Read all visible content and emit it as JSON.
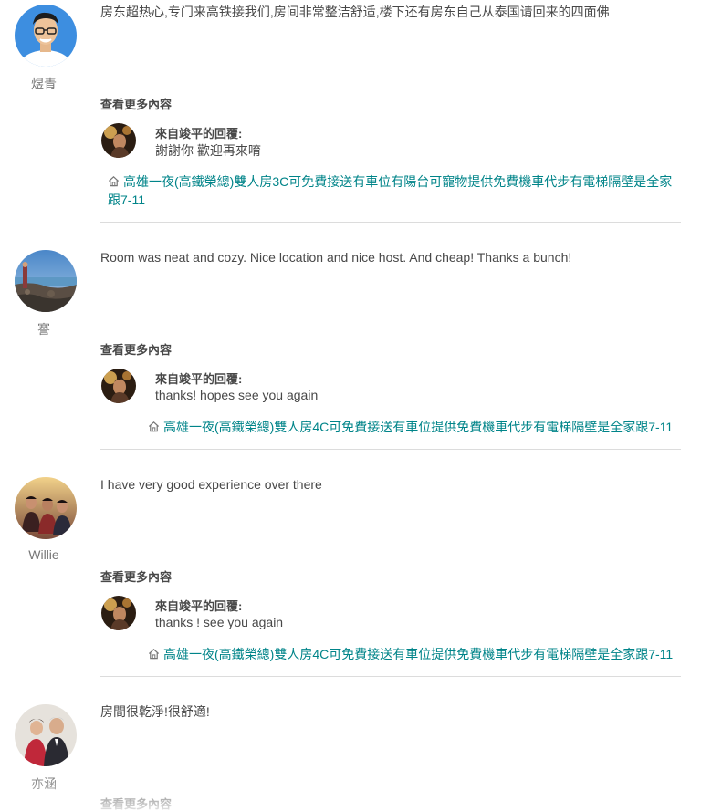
{
  "reviews": [
    {
      "reviewer": "煜青",
      "text": "房东超热心,专门来高铁接我们,房间非常整洁舒适,楼下还有房东自己从泰国请回来的四面佛",
      "see_more": "查看更多內容",
      "reply_from": "來自竣平的回覆:",
      "reply_text": "謝謝你 歡迎再來唷",
      "listing": "高雄一夜(高鐵榮總)雙人房3C可免費接送有車位有陽台可寵物提供免費機車代步有電梯隔壁是全家跟7-11"
    },
    {
      "reviewer": "謇",
      "text": "Room was neat and cozy. Nice location and nice host. And cheap! Thanks a bunch!",
      "see_more": "查看更多內容",
      "reply_from": "來自竣平的回覆:",
      "reply_text": "thanks! hopes see you again",
      "listing": "高雄一夜(高鐵榮總)雙人房4C可免費接送有車位提供免費機車代步有電梯隔壁是全家跟7-11"
    },
    {
      "reviewer": "Willie",
      "text": "I have very good experience over there",
      "see_more": "查看更多內容",
      "reply_from": "來自竣平的回覆:",
      "reply_text": "thanks ! see you again",
      "listing": "高雄一夜(高鐵榮總)雙人房4C可免費接送有車位提供免費機車代步有電梯隔壁是全家跟7-11"
    },
    {
      "reviewer": "亦涵",
      "text": "房間很乾淨!很舒適!",
      "see_more": "查看更多內容"
    }
  ],
  "icons": {
    "listing_icon": "home-icon"
  },
  "colors": {
    "link": "#008489",
    "text": "#484848",
    "muted": "#767676",
    "divider": "#dcdcdc"
  }
}
